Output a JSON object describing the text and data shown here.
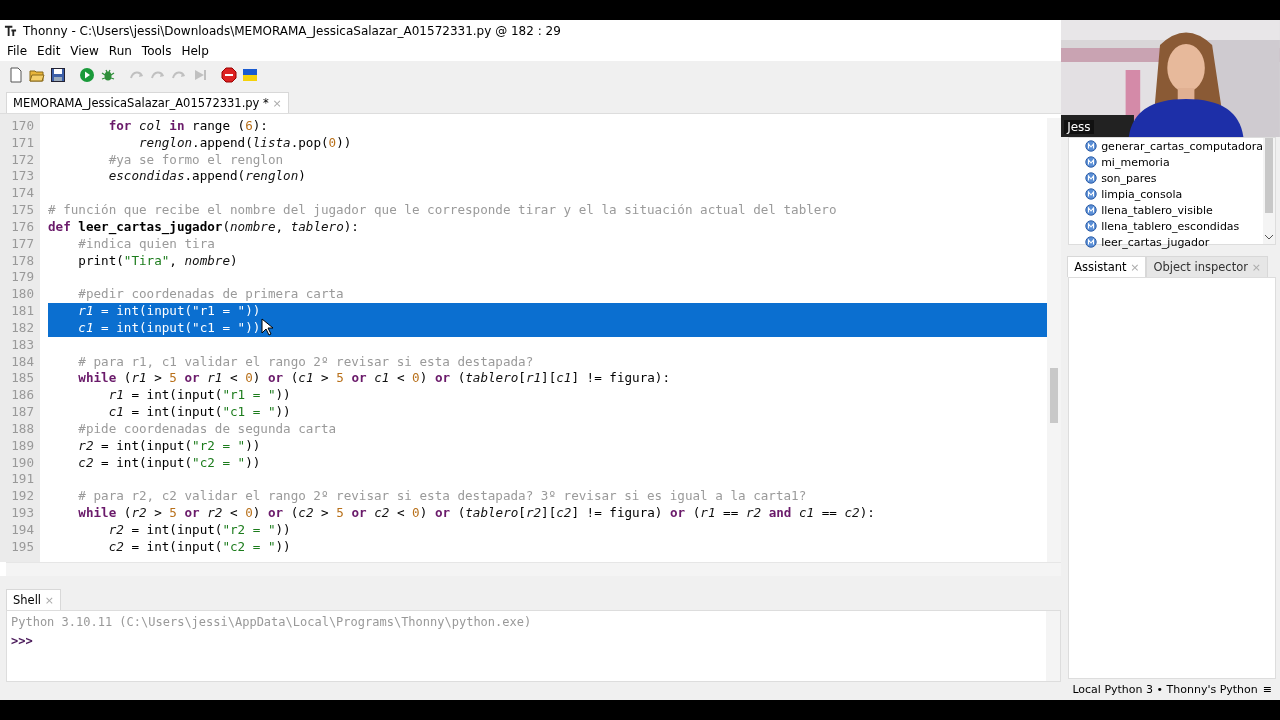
{
  "window": {
    "title": "Thonny  -  C:\\Users\\jessi\\Downloads\\MEMORAMA_JessicaSalazar_A01572331.py  @  182 : 29"
  },
  "menu": [
    "File",
    "Edit",
    "View",
    "Run",
    "Tools",
    "Help"
  ],
  "toolbar": [
    {
      "kind": "new",
      "disabled": false
    },
    {
      "kind": "open",
      "disabled": false
    },
    {
      "kind": "save",
      "disabled": false
    },
    {
      "kind": "run",
      "disabled": false
    },
    {
      "kind": "debug",
      "disabled": false
    },
    {
      "kind": "step-over",
      "disabled": true
    },
    {
      "kind": "step-into",
      "disabled": true
    },
    {
      "kind": "step-out",
      "disabled": true
    },
    {
      "kind": "resume",
      "disabled": true
    },
    {
      "kind": "stop",
      "disabled": false
    },
    {
      "kind": "flag",
      "disabled": false
    }
  ],
  "editor_tabs": [
    {
      "label": "MEMORAMA_JessicaSalazar_A01572331.py *",
      "close": "×",
      "selected": true
    }
  ],
  "editor": {
    "lines": [
      {
        "num": "170",
        "selected": false,
        "tokens": [
          {
            "text": "        for ",
            "kind": "kw"
          },
          {
            "text": "col ",
            "kind": "var"
          },
          {
            "text": "in",
            "kind": "kw"
          },
          {
            "text": " range (",
            "kind": "p"
          },
          {
            "text": "6",
            "kind": "num"
          },
          {
            "text": "):",
            "kind": "p"
          }
        ]
      },
      {
        "num": "171",
        "selected": false,
        "tokens": [
          {
            "text": "            renglon",
            "kind": "var"
          },
          {
            "text": ".append(",
            "kind": "p"
          },
          {
            "text": "lista",
            "kind": "var"
          },
          {
            "text": ".pop(",
            "kind": "p"
          },
          {
            "text": "0",
            "kind": "num"
          },
          {
            "text": "))",
            "kind": "p"
          }
        ]
      },
      {
        "num": "172",
        "selected": false,
        "tokens": [
          {
            "text": "        #ya se formo el renglon",
            "kind": "c"
          }
        ]
      },
      {
        "num": "173",
        "selected": false,
        "tokens": [
          {
            "text": "        escondidas",
            "kind": "var"
          },
          {
            "text": ".append(",
            "kind": "p"
          },
          {
            "text": "renglon",
            "kind": "var"
          },
          {
            "text": ")",
            "kind": "p"
          }
        ]
      },
      {
        "num": "174",
        "selected": false
      },
      {
        "num": "175",
        "selected": false,
        "tokens": [
          {
            "text": "# función que recibe el nombre del jugador que le corresponde tirar y el la situación actual del tablero",
            "kind": "c"
          }
        ]
      },
      {
        "num": "176",
        "selected": false,
        "tokens": [
          {
            "text": "def ",
            "kind": "kw"
          },
          {
            "text": "leer_cartas_jugador",
            "kind": "fn"
          },
          {
            "text": "(",
            "kind": "p"
          },
          {
            "text": "nombre",
            "kind": "var"
          },
          {
            "text": ", ",
            "kind": "p"
          },
          {
            "text": "tablero",
            "kind": "var"
          },
          {
            "text": "):",
            "kind": "p"
          }
        ]
      },
      {
        "num": "177",
        "selected": false,
        "tokens": [
          {
            "text": "    #indica quien tira",
            "kind": "c"
          }
        ]
      },
      {
        "num": "178",
        "selected": false,
        "tokens": [
          {
            "text": "    print(",
            "kind": "p"
          },
          {
            "text": "\"Tira\"",
            "kind": "str"
          },
          {
            "text": ", ",
            "kind": "p"
          },
          {
            "text": "nombre",
            "kind": "var"
          },
          {
            "text": ")",
            "kind": "p"
          }
        ]
      },
      {
        "num": "179",
        "selected": false
      },
      {
        "num": "180",
        "selected": false,
        "tokens": [
          {
            "text": "    #pedir coordenadas de primera carta",
            "kind": "c"
          }
        ]
      },
      {
        "num": "181",
        "selected": true,
        "tokens": [
          {
            "text": "    r1",
            "kind": "var"
          },
          {
            "text": " = int(input(",
            "kind": "p"
          },
          {
            "text": "\"r1 = \"",
            "kind": "str"
          },
          {
            "text": "))",
            "kind": "p"
          }
        ]
      },
      {
        "num": "182",
        "selected": true,
        "tokens": [
          {
            "text": "    c1",
            "kind": "var"
          },
          {
            "text": " = int(input(",
            "kind": "p"
          },
          {
            "text": "\"c1 = \"",
            "kind": "str"
          },
          {
            "text": "))",
            "kind": "p"
          }
        ]
      },
      {
        "num": "183",
        "selected": false
      },
      {
        "num": "184",
        "selected": false,
        "tokens": [
          {
            "text": "    # para r1, c1 validar el rango 2º revisar si esta destapada?",
            "kind": "c"
          }
        ]
      },
      {
        "num": "185",
        "selected": false,
        "tokens": [
          {
            "text": "    while",
            "kind": "kw"
          },
          {
            "text": " (",
            "kind": "p"
          },
          {
            "text": "r1",
            "kind": "var"
          },
          {
            "text": " > ",
            "kind": "p"
          },
          {
            "text": "5",
            "kind": "num"
          },
          {
            "text": " or ",
            "kind": "kw"
          },
          {
            "text": "r1",
            "kind": "var"
          },
          {
            "text": " < ",
            "kind": "p"
          },
          {
            "text": "0",
            "kind": "num"
          },
          {
            "text": ")",
            "kind": "p"
          },
          {
            "text": " or ",
            "kind": "kw"
          },
          {
            "text": "(",
            "kind": "p"
          },
          {
            "text": "c1",
            "kind": "var"
          },
          {
            "text": " > ",
            "kind": "p"
          },
          {
            "text": "5",
            "kind": "num"
          },
          {
            "text": " or ",
            "kind": "kw"
          },
          {
            "text": "c1",
            "kind": "var"
          },
          {
            "text": " < ",
            "kind": "p"
          },
          {
            "text": "0",
            "kind": "num"
          },
          {
            "text": ")",
            "kind": "p"
          },
          {
            "text": " or ",
            "kind": "kw"
          },
          {
            "text": "(",
            "kind": "p"
          },
          {
            "text": "tablero",
            "kind": "var"
          },
          {
            "text": "[",
            "kind": "p"
          },
          {
            "text": "r1",
            "kind": "var"
          },
          {
            "text": "][",
            "kind": "p"
          },
          {
            "text": "c1",
            "kind": "var"
          },
          {
            "text": "] != figura):",
            "kind": "p"
          }
        ]
      },
      {
        "num": "186",
        "selected": false,
        "tokens": [
          {
            "text": "        r1",
            "kind": "var"
          },
          {
            "text": " = int(input(",
            "kind": "p"
          },
          {
            "text": "\"r1 = \"",
            "kind": "str"
          },
          {
            "text": "))",
            "kind": "p"
          }
        ]
      },
      {
        "num": "187",
        "selected": false,
        "tokens": [
          {
            "text": "        c1",
            "kind": "var"
          },
          {
            "text": " = int(input(",
            "kind": "p"
          },
          {
            "text": "\"c1 = \"",
            "kind": "str"
          },
          {
            "text": "))",
            "kind": "p"
          }
        ]
      },
      {
        "num": "188",
        "selected": false,
        "tokens": [
          {
            "text": "    #pide coordenadas de segunda carta",
            "kind": "c"
          }
        ]
      },
      {
        "num": "189",
        "selected": false,
        "tokens": [
          {
            "text": "    r2",
            "kind": "var"
          },
          {
            "text": " = int(input(",
            "kind": "p"
          },
          {
            "text": "\"r2 = \"",
            "kind": "str"
          },
          {
            "text": "))",
            "kind": "p"
          }
        ]
      },
      {
        "num": "190",
        "selected": false,
        "tokens": [
          {
            "text": "    c2",
            "kind": "var"
          },
          {
            "text": " = int(input(",
            "kind": "p"
          },
          {
            "text": "\"c2 = \"",
            "kind": "str"
          },
          {
            "text": "))",
            "kind": "p"
          }
        ]
      },
      {
        "num": "191",
        "selected": false
      },
      {
        "num": "192",
        "selected": false,
        "tokens": [
          {
            "text": "    # para r2, c2 validar el rango 2º revisar si esta destapada? 3º revisar si es igual a la carta1?",
            "kind": "c"
          }
        ]
      },
      {
        "num": "193",
        "selected": false,
        "tokens": [
          {
            "text": "    while",
            "kind": "kw"
          },
          {
            "text": " (",
            "kind": "p"
          },
          {
            "text": "r2",
            "kind": "var"
          },
          {
            "text": " > ",
            "kind": "p"
          },
          {
            "text": "5",
            "kind": "num"
          },
          {
            "text": " or ",
            "kind": "kw"
          },
          {
            "text": "r2",
            "kind": "var"
          },
          {
            "text": " < ",
            "kind": "p"
          },
          {
            "text": "0",
            "kind": "num"
          },
          {
            "text": ")",
            "kind": "p"
          },
          {
            "text": " or ",
            "kind": "kw"
          },
          {
            "text": "(",
            "kind": "p"
          },
          {
            "text": "c2",
            "kind": "var"
          },
          {
            "text": " > ",
            "kind": "p"
          },
          {
            "text": "5",
            "kind": "num"
          },
          {
            "text": " or ",
            "kind": "kw"
          },
          {
            "text": "c2",
            "kind": "var"
          },
          {
            "text": " < ",
            "kind": "p"
          },
          {
            "text": "0",
            "kind": "num"
          },
          {
            "text": ")",
            "kind": "p"
          },
          {
            "text": " or ",
            "kind": "kw"
          },
          {
            "text": "(",
            "kind": "p"
          },
          {
            "text": "tablero",
            "kind": "var"
          },
          {
            "text": "[",
            "kind": "p"
          },
          {
            "text": "r2",
            "kind": "var"
          },
          {
            "text": "][",
            "kind": "p"
          },
          {
            "text": "c2",
            "kind": "var"
          },
          {
            "text": "] != figura)",
            "kind": "p"
          },
          {
            "text": " or ",
            "kind": "kw"
          },
          {
            "text": "(",
            "kind": "p"
          },
          {
            "text": "r1",
            "kind": "var"
          },
          {
            "text": " == ",
            "kind": "p"
          },
          {
            "text": "r2",
            "kind": "var"
          },
          {
            "text": " and ",
            "kind": "kw"
          },
          {
            "text": "c1",
            "kind": "var"
          },
          {
            "text": " == ",
            "kind": "p"
          },
          {
            "text": "c2",
            "kind": "var"
          },
          {
            "text": "):",
            "kind": "p"
          }
        ]
      },
      {
        "num": "194",
        "selected": false,
        "tokens": [
          {
            "text": "        r2",
            "kind": "var"
          },
          {
            "text": " = int(input(",
            "kind": "p"
          },
          {
            "text": "\"r2 = \"",
            "kind": "str"
          },
          {
            "text": "))",
            "kind": "p"
          }
        ]
      },
      {
        "num": "195",
        "selected": false,
        "tokens": [
          {
            "text": "        c2",
            "kind": "var"
          },
          {
            "text": " = int(input(",
            "kind": "p"
          },
          {
            "text": "\"c2 = \"",
            "kind": "str"
          },
          {
            "text": "))",
            "kind": "p"
          }
        ]
      }
    ]
  },
  "shell": {
    "tab": {
      "label": "Shell",
      "close": "×",
      "selected": true
    },
    "banner": "Python 3.10.11 (C:\\Users\\jessi\\AppData\\Local\\Programs\\Thonny\\python.exe)",
    "prompt": ">>>"
  },
  "webcam": {
    "kind": "picture",
    "name": "Jess"
  },
  "outline": {
    "items": [
      "generar_cartas_computadora",
      "mi_memoria",
      "son_pares",
      "limpia_consola",
      "llena_tablero_visible",
      "llena_tablero_escondidas",
      "leer_cartas_jugador"
    ]
  },
  "side_tabs": [
    {
      "label": "Assistant",
      "close": "×",
      "selected": true
    },
    {
      "label": "Object inspector",
      "close": "×",
      "selected": false
    }
  ],
  "status_bar": {
    "text": "Local Python 3  •  Thonny's Python",
    "menu": "≡"
  }
}
